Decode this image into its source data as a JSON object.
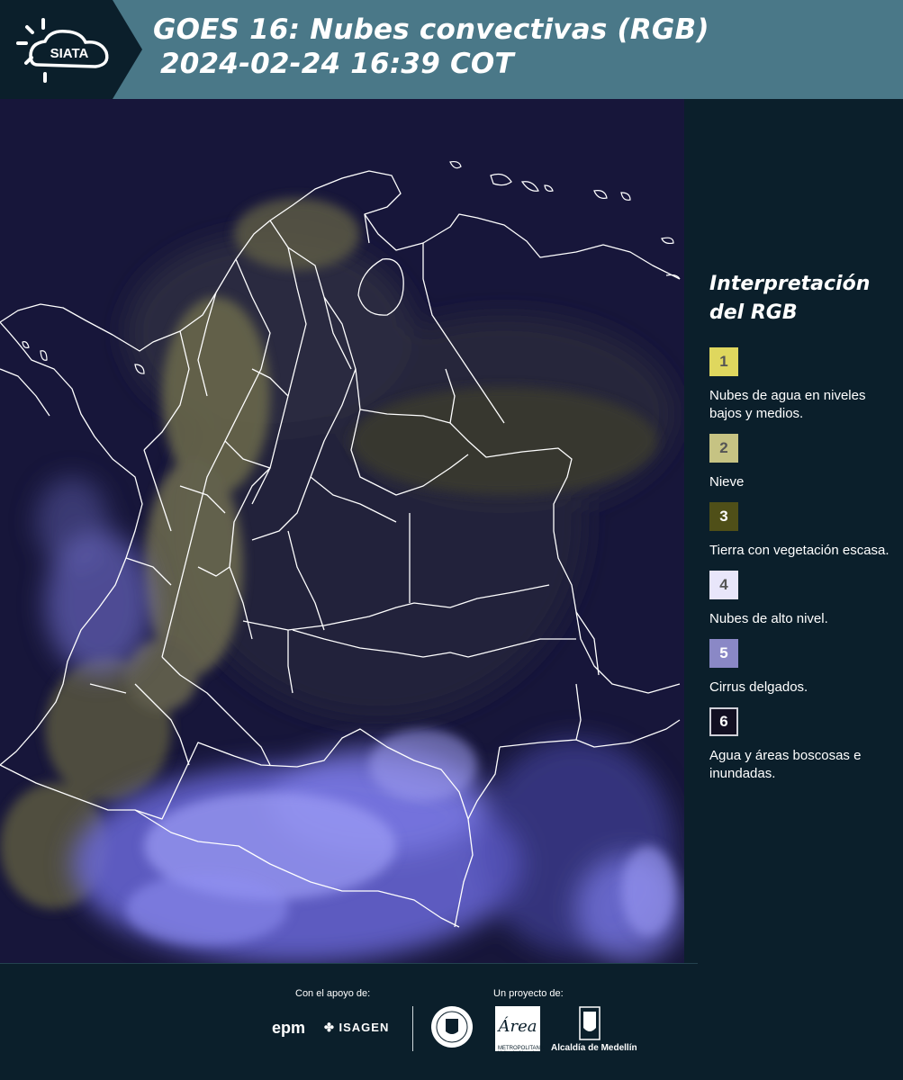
{
  "header": {
    "logo_text": "SIATA",
    "title_line1": "GOES 16: Nubes convectivas (RGB)",
    "title_line2": "2024-02-24 16:39 COT"
  },
  "legend": {
    "title_line1": "Interpretación",
    "title_line2": "del RGB",
    "items": [
      {
        "number": "1",
        "color": "#dfd75e",
        "label": "Nubes de agua en niveles bajos y medios."
      },
      {
        "number": "2",
        "color": "#c6c383",
        "label": "Nieve"
      },
      {
        "number": "3",
        "color": "#4f4f18",
        "label": "Tierra con vegetación escasa."
      },
      {
        "number": "4",
        "color": "#e8e6fa",
        "label": "Nubes de alto nivel."
      },
      {
        "number": "5",
        "color": "#8a88c6",
        "label": "Cirrus delgados."
      },
      {
        "number": "6",
        "color": "#120f22",
        "label": "Agua y áreas boscosas e inundadas."
      }
    ]
  },
  "footer": {
    "support_label": "Con el apoyo de:",
    "project_label": "Un proyecto de:",
    "sponsors": [
      "epm",
      "ISAGEN"
    ],
    "area_logo_text": "METROPOLITANA Valle de Aburrá",
    "alcaldia_text": "Alcaldía de Medellín"
  },
  "colors": {
    "header_bg": "#4a7888",
    "page_bg": "#0b1f2b",
    "map_bg": "#16163a",
    "cloud": "#8c8cff",
    "border_line": "#ffffff"
  }
}
